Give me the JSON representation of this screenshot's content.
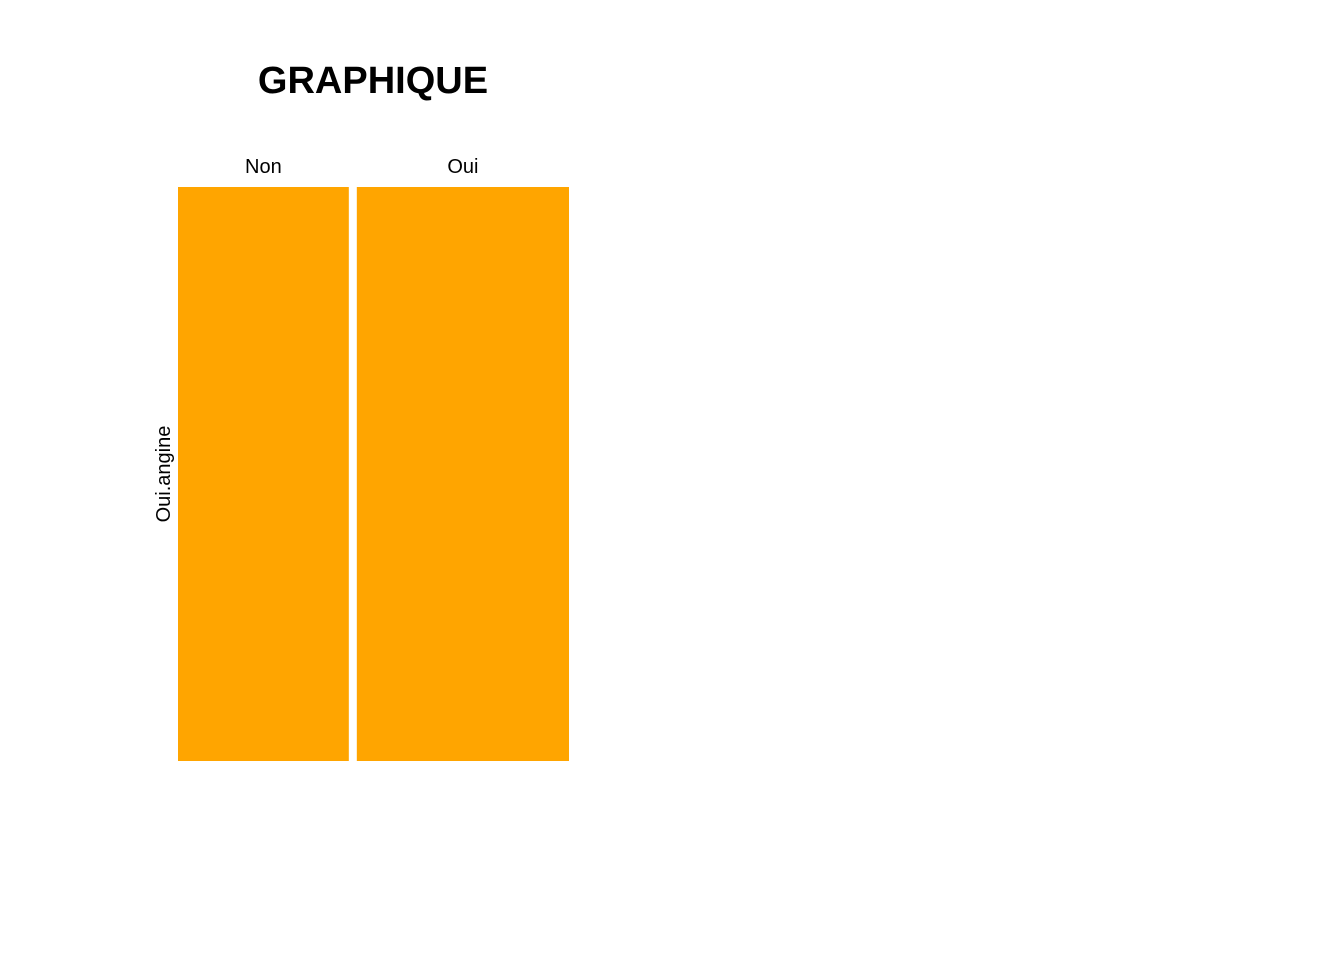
{
  "chart_data": {
    "type": "mosaic",
    "title": "GRAPHIQUE",
    "columns": [
      "Non",
      "Oui"
    ],
    "rows": [
      "Oui.angine"
    ],
    "column_proportions": [
      0.446,
      0.554
    ],
    "cells": [
      {
        "column": "Non",
        "row": "Oui.angine",
        "share": 1.0
      },
      {
        "column": "Oui",
        "row": "Oui.angine",
        "share": 1.0
      }
    ],
    "fill_color": "#FFA500",
    "grid": false,
    "legend": "none"
  }
}
